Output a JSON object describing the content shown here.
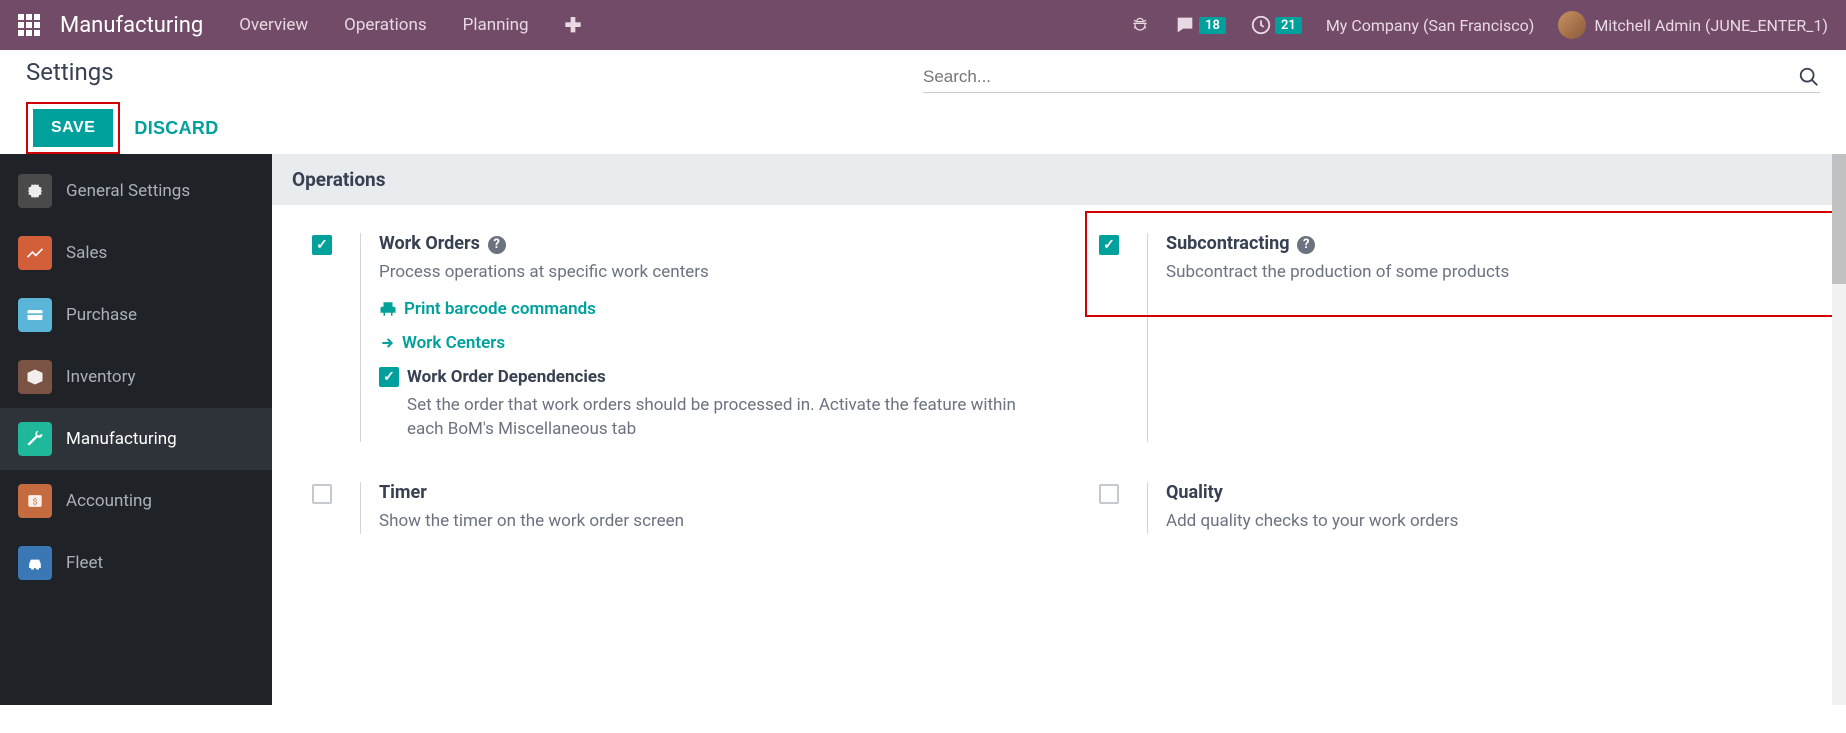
{
  "topbar": {
    "brand": "Manufacturing",
    "nav": [
      "Overview",
      "Operations",
      "Planning"
    ],
    "messages_badge": "18",
    "activities_badge": "21",
    "company": "My Company (San Francisco)",
    "user": "Mitchell Admin (JUNE_ENTER_1)"
  },
  "subheader": {
    "title": "Settings",
    "save": "SAVE",
    "discard": "DISCARD",
    "search_placeholder": "Search..."
  },
  "sidebar": {
    "items": [
      {
        "label": "General Settings"
      },
      {
        "label": "Sales"
      },
      {
        "label": "Purchase"
      },
      {
        "label": "Inventory"
      },
      {
        "label": "Manufacturing"
      },
      {
        "label": "Accounting"
      },
      {
        "label": "Fleet"
      }
    ]
  },
  "section": {
    "title": "Operations"
  },
  "settings": {
    "workorders": {
      "title": "Work Orders",
      "desc": "Process operations at specific work centers",
      "link1": "Print barcode commands",
      "link2": "Work Centers",
      "sub_title": "Work Order Dependencies",
      "sub_desc": "Set the order that work orders should be processed in. Activate the feature within each BoM's Miscellaneous tab"
    },
    "subcontracting": {
      "title": "Subcontracting",
      "desc": "Subcontract the production of some products"
    },
    "timer": {
      "title": "Timer",
      "desc": "Show the timer on the work order screen"
    },
    "quality": {
      "title": "Quality",
      "desc": "Add quality checks to your work orders"
    }
  }
}
